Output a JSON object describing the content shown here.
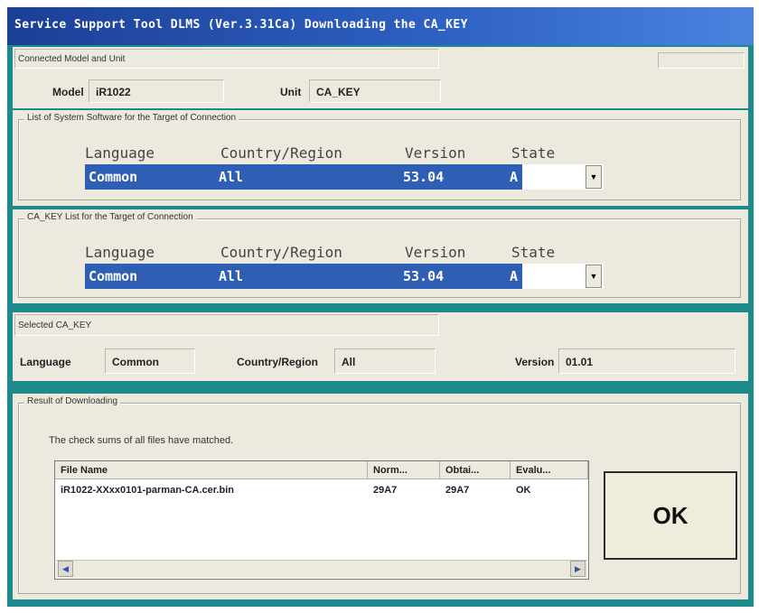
{
  "window": {
    "title": "Service Support Tool DLMS (Ver.3.31Ca) Downloading the CA_KEY"
  },
  "connected": {
    "section_label": "Connected Model and Unit",
    "model_label": "Model",
    "model_value": "iR1022",
    "unit_label": "Unit",
    "unit_value": "CA_KEY"
  },
  "system_software": {
    "legend": "List of System Software for the Target of Connection",
    "headers": {
      "language": "Language",
      "country": "Country/Region",
      "version": "Version",
      "state": "State"
    },
    "selected_row": {
      "language": "Common",
      "country": "All",
      "version": "53.04",
      "state": "A"
    }
  },
  "cakey_list": {
    "legend": "CA_KEY List for the Target of Connection",
    "headers": {
      "language": "Language",
      "country": "Country/Region",
      "version": "Version",
      "state": "State"
    },
    "selected_row": {
      "language": "Common",
      "country": "All",
      "version": "53.04",
      "state": "A"
    }
  },
  "selected_cakey": {
    "section_label": "Selected CA_KEY",
    "language_label": "Language",
    "language_value": "Common",
    "country_label": "Country/Region",
    "country_value": "All",
    "version_label": "Version",
    "version_value": "01.01"
  },
  "result": {
    "legend": "Result of Downloading",
    "message": "The check sums of all files have matched.",
    "columns": [
      "File Name",
      "Norm...",
      "Obtai...",
      "Evalu..."
    ],
    "rows": [
      [
        "iR1022-XXxx0101-parman-CA.cer.bin",
        "29A7",
        "29A7",
        "OK"
      ]
    ]
  },
  "ok_button": {
    "label": "OK"
  },
  "icons": {
    "dropdown": "chevron-down-icon",
    "scroll_left": "arrow-left-icon",
    "scroll_right": "arrow-right-icon"
  }
}
